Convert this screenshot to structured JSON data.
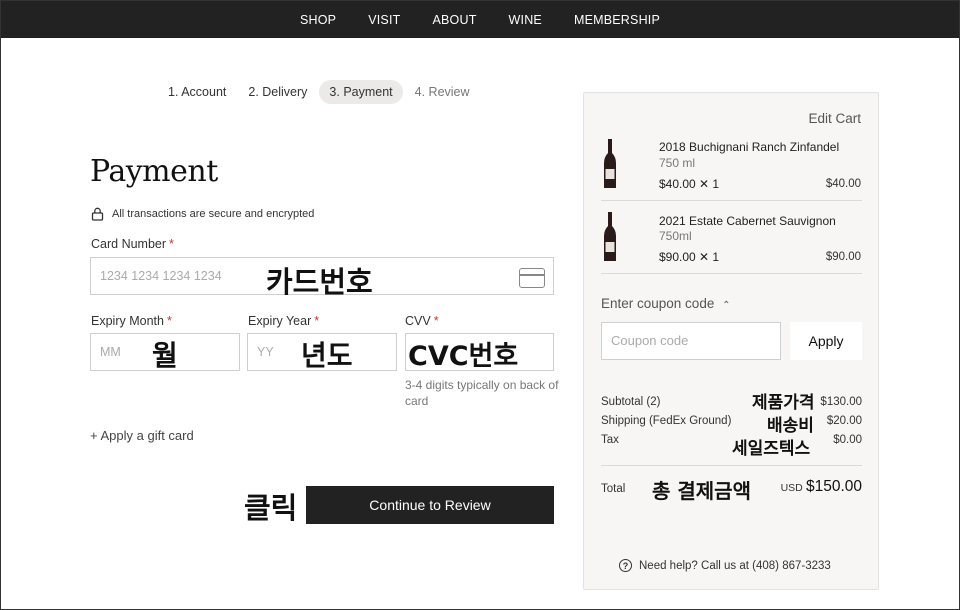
{
  "nav": [
    "SHOP",
    "VISIT",
    "ABOUT",
    "WINE",
    "MEMBERSHIP"
  ],
  "steps": [
    "1. Account",
    "2. Delivery",
    "3. Payment",
    "4. Review"
  ],
  "page": {
    "title": "Payment",
    "secure_text": "All transactions are secure and encrypted"
  },
  "card": {
    "label": "Card Number",
    "placeholder": "1234 1234 1234 1234",
    "overlay": "카드번호"
  },
  "expiry_month": {
    "label": "Expiry Month",
    "placeholder": "MM",
    "overlay": "월"
  },
  "expiry_year": {
    "label": "Expiry Year",
    "placeholder": "YY",
    "overlay": "년도"
  },
  "cvv": {
    "label": "CVV",
    "overlay": "CVC번호",
    "hint": "3-4 digits typically on back of card"
  },
  "required_mark": "*",
  "gift_link": "+ Apply a gift card",
  "continue": {
    "label": "Continue to Review",
    "overlay": "클릭"
  },
  "cart": {
    "edit": "Edit Cart",
    "items": [
      {
        "name": "2018 Buchignani Ranch Zinfandel",
        "size": "750 ml",
        "qty": "$40.00 ✕ 1",
        "total": "$40.00"
      },
      {
        "name": "2021 Estate Cabernet Sauvignon",
        "size": "750ml",
        "qty": "$90.00 ✕ 1",
        "total": "$90.00"
      }
    ]
  },
  "coupon": {
    "toggle": "Enter coupon code",
    "placeholder": "Coupon code",
    "apply": "Apply"
  },
  "summary": {
    "subtotal_label": "Subtotal (2)",
    "subtotal_value": "$130.00",
    "subtotal_overlay": "제품가격",
    "shipping_label": "Shipping (FedEx Ground)",
    "shipping_value": "$20.00",
    "shipping_overlay": "배송비",
    "tax_label": "Tax",
    "tax_value": "$0.00",
    "tax_overlay": "세일즈텍스",
    "total_label": "Total",
    "total_currency": "USD",
    "total_value": "$150.00",
    "total_overlay": "총 결제금액"
  },
  "help": "Need help? Call us at (408) 867-3233",
  "colors": {
    "nav_bg": "#222222",
    "button_bg": "#222222",
    "required": "#c0392b",
    "panel_bg": "#f7f6f5"
  }
}
